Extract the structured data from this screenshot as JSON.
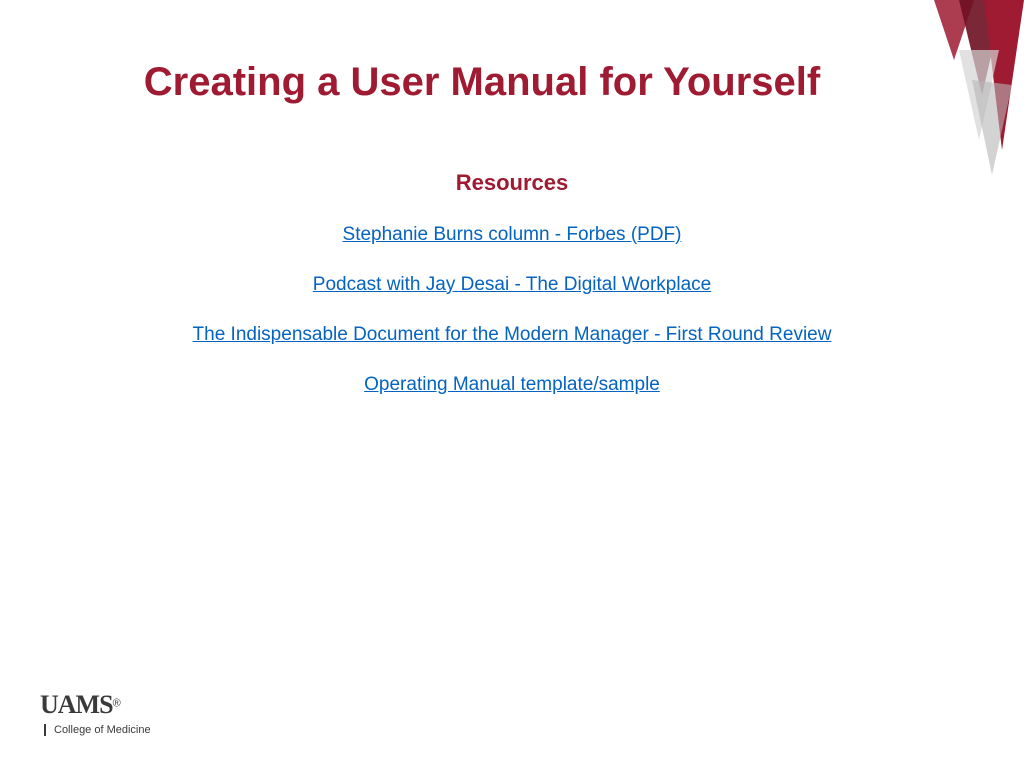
{
  "title": "Creating a User Manual for Yourself",
  "section_heading": "Resources",
  "links": [
    "Stephanie Burns column - Forbes (PDF)",
    "Podcast with Jay Desai - The Digital Workplace",
    "The Indispensable Document for the Modern Manager - First Round Review",
    "Operating Manual template/sample"
  ],
  "logo": {
    "main": "UAMS",
    "registered": "®",
    "subtitle": "College of Medicine"
  },
  "colors": {
    "brand": "#9e1b32",
    "link": "#0563c1"
  }
}
